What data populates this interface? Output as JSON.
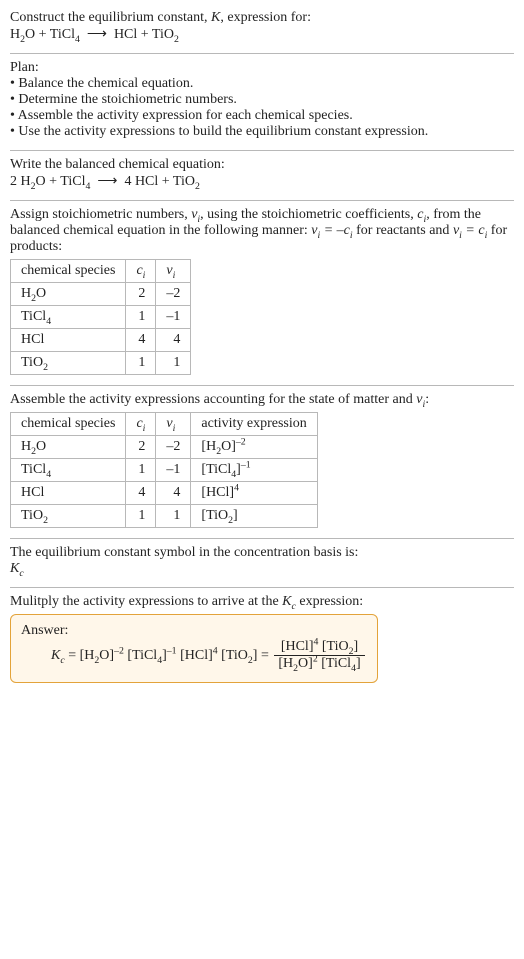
{
  "intro": {
    "line1_a": "Construct the equilibrium constant, ",
    "line1_b": ", expression for:"
  },
  "plan": {
    "title": "Plan:",
    "b1": "• Balance the chemical equation.",
    "b2": "• Determine the stoichiometric numbers.",
    "b3": "• Assemble the activity expression for each chemical species.",
    "b4": "• Use the activity expressions to build the equilibrium constant expression."
  },
  "balanced_intro": "Write the balanced chemical equation:",
  "stoich_intro_a": "Assign stoichiometric numbers, ",
  "stoich_intro_b": ", using the stoichiometric coefficients, ",
  "stoich_intro_c": ", from the balanced chemical equation in the following manner: ",
  "stoich_intro_d": " for reactants and ",
  "stoich_intro_e": " for products:",
  "table1": {
    "h1": "chemical species",
    "r1": {
      "c": "2",
      "v": "–2"
    },
    "r2": {
      "c": "1",
      "v": "–1"
    },
    "r3": {
      "c": "4",
      "v": "4"
    },
    "r4": {
      "c": "1",
      "v": "1"
    }
  },
  "activity_intro_a": "Assemble the activity expressions accounting for the state of matter and ",
  "activity_intro_b": ":",
  "table2": {
    "h1": "chemical species",
    "h4": "activity expression",
    "r1": {
      "c": "2",
      "v": "–2"
    },
    "r2": {
      "c": "1",
      "v": "–1"
    },
    "r3": {
      "c": "4",
      "v": "4"
    },
    "r4": {
      "c": "1",
      "v": "1"
    }
  },
  "ksym_line": "The equilibrium constant symbol in the concentration basis is:",
  "mult_line_a": "Mulitply the activity expressions to arrive at the ",
  "mult_line_b": " expression:",
  "answer_label": "Answer:"
}
